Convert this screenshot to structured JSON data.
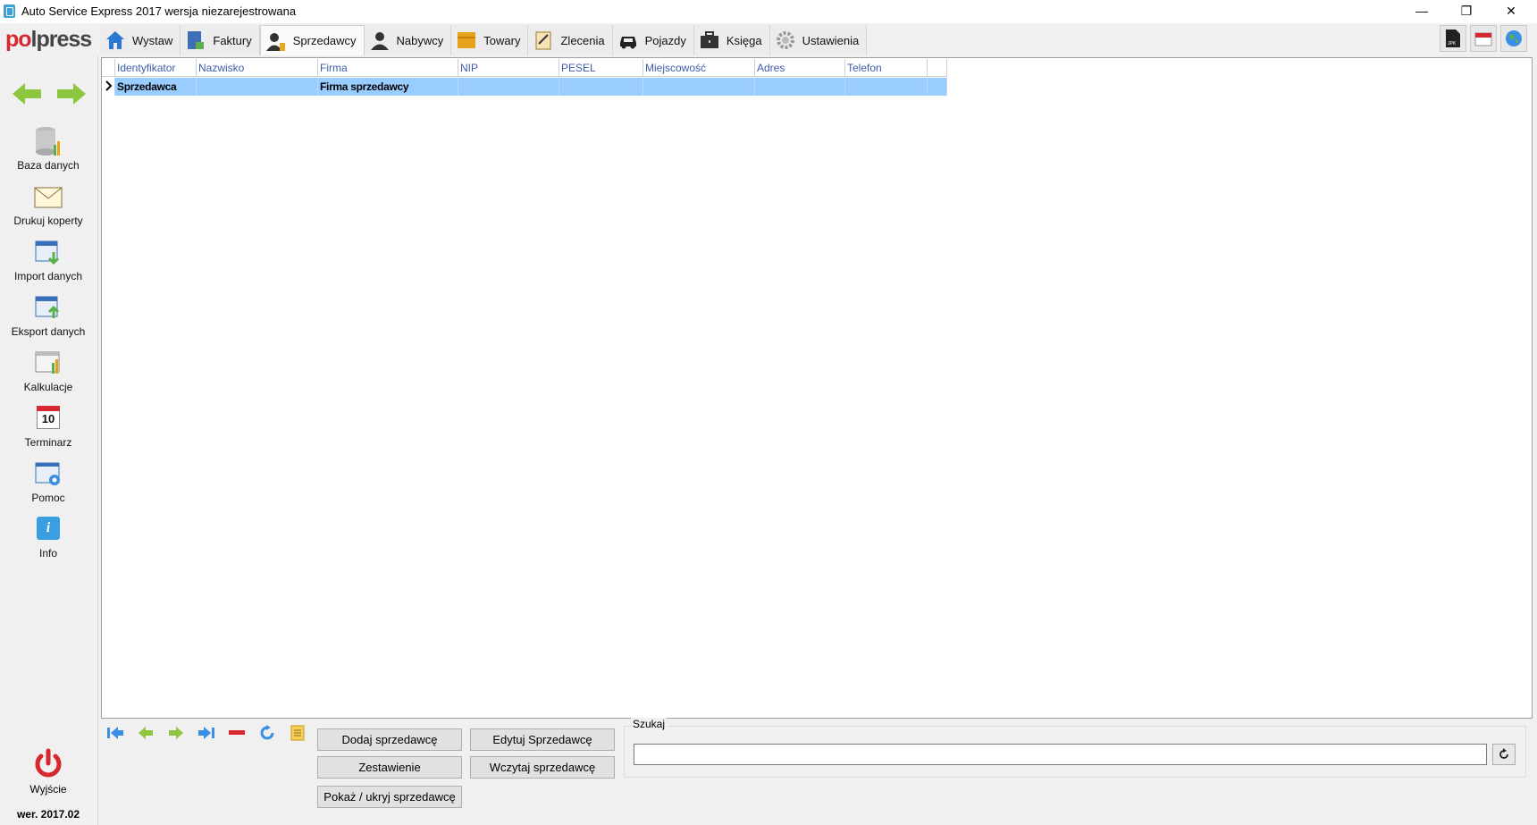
{
  "window": {
    "title": "Auto Service Express 2017 wersja niezarejestrowana",
    "min_glyph": "—",
    "max_glyph": "❐",
    "close_glyph": "✕"
  },
  "logo": {
    "part1": "po",
    "part2": "lpress"
  },
  "tabs": [
    {
      "label": "Wystaw",
      "icon": "home-icon"
    },
    {
      "label": "Faktury",
      "icon": "invoice-icon"
    },
    {
      "label": "Sprzedawcy",
      "icon": "seller-icon",
      "active": true
    },
    {
      "label": "Nabywcy",
      "icon": "buyer-icon"
    },
    {
      "label": "Towary",
      "icon": "goods-icon"
    },
    {
      "label": "Zlecenia",
      "icon": "order-icon"
    },
    {
      "label": "Pojazdy",
      "icon": "car-icon"
    },
    {
      "label": "Księga",
      "icon": "briefcase-icon"
    },
    {
      "label": "Ustawienia",
      "icon": "gear-icon"
    }
  ],
  "topright": {
    "jpk_label": "JPK"
  },
  "sidebar": {
    "items": [
      {
        "label": "Baza danych",
        "icon": "database-icon"
      },
      {
        "label": "Drukuj koperty",
        "icon": "envelope-icon"
      },
      {
        "label": "Import danych",
        "icon": "import-icon"
      },
      {
        "label": "Eksport danych",
        "icon": "export-icon"
      },
      {
        "label": "Kalkulacje",
        "icon": "calculator-icon"
      },
      {
        "label": "Terminarz",
        "icon": "calendar-icon",
        "badge": "10"
      },
      {
        "label": "Pomoc",
        "icon": "help-icon"
      },
      {
        "label": "Info",
        "icon": "info-icon",
        "badge": "i"
      }
    ],
    "exit_label": "Wyjście",
    "version": "wer. 2017.02"
  },
  "grid": {
    "columns": [
      "Identyfikator",
      "Nazwisko",
      "Firma",
      "NIP",
      "PESEL",
      "Miejscowość",
      "Adres",
      "Telefon"
    ],
    "rows": [
      [
        "Sprzedawca",
        "",
        "Firma sprzedawcy",
        "",
        "",
        "",
        "",
        ""
      ]
    ],
    "selected_color": "#99ccff"
  },
  "buttons": {
    "add": "Dodaj sprzedawcę",
    "edit": "Edytuj Sprzedawcę",
    "summary": "Zestawienie",
    "load": "Wczytaj sprzedawcę",
    "toggle": "Pokaż / ukryj sprzedawcę"
  },
  "search": {
    "label": "Szukaj",
    "value": ""
  },
  "colors": {
    "accent_green": "#8dc63f",
    "nav_blue": "#3a8ee6",
    "brand_red": "#d7282f"
  }
}
